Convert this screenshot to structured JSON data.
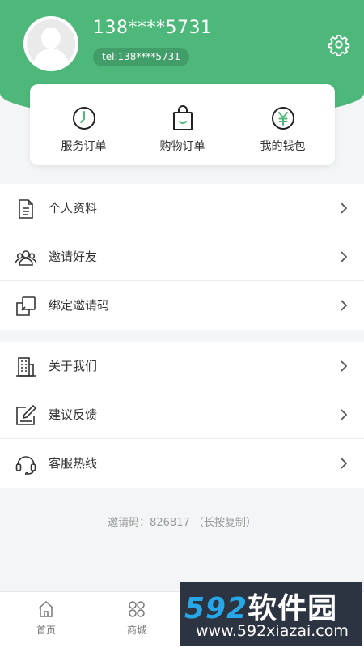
{
  "user": {
    "phone": "138****5731",
    "tel": "tel:138****5731"
  },
  "colors": {
    "brand": "#4db87a"
  },
  "quick_actions": [
    {
      "label": "服务订单",
      "icon": "clock-icon"
    },
    {
      "label": "购物订单",
      "icon": "shopping-bag-icon"
    },
    {
      "label": "我的钱包",
      "icon": "yuan-coin-icon"
    }
  ],
  "menu_group_1": [
    {
      "label": "个人资料",
      "icon": "document-icon"
    },
    {
      "label": "邀请好友",
      "icon": "people-icon"
    },
    {
      "label": "绑定邀请码",
      "icon": "copy-icon"
    }
  ],
  "menu_group_2": [
    {
      "label": "关于我们",
      "icon": "building-icon"
    },
    {
      "label": "建议反馈",
      "icon": "edit-icon"
    },
    {
      "label": "客服热线",
      "icon": "headset-icon"
    }
  ],
  "invite_text": "邀请码：826817 （长按复制）",
  "tabs": [
    {
      "label": "首页",
      "icon": "home-icon"
    },
    {
      "label": "商城",
      "icon": "grid-icon"
    }
  ],
  "watermark": {
    "digits": "592",
    "text": "软件园",
    "url": "www.592xiazai.com"
  }
}
